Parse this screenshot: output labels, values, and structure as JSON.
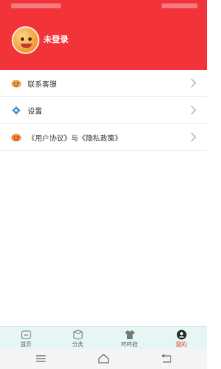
{
  "profile": {
    "login_label": "未登录"
  },
  "menu": {
    "items": [
      {
        "label": "联系客服",
        "icon": "service-mascot-icon"
      },
      {
        "label": "设置",
        "icon": "gear-icon"
      },
      {
        "label": "《用户协议》与《隐私政策》",
        "icon": "mascot-icon"
      }
    ]
  },
  "tabbar": {
    "tabs": [
      {
        "label": "首页",
        "icon": "home-chat-icon"
      },
      {
        "label": "分类",
        "icon": "category-icon"
      },
      {
        "label": "咚咚抢",
        "icon": "shirt-icon"
      },
      {
        "label": "我的",
        "icon": "profile-icon",
        "active": true
      }
    ]
  },
  "colors": {
    "header_red": "#f2343a",
    "tab_active": "#e53935",
    "tabbar_bg": "#e6f6f4"
  }
}
